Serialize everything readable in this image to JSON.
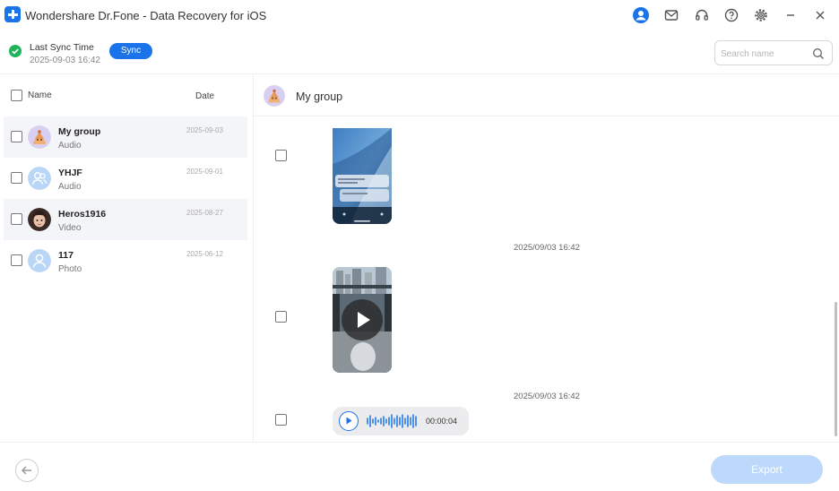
{
  "window": {
    "title": "Wondershare Dr.Fone - Data Recovery for iOS",
    "accent": "#1a73e8",
    "icons": [
      "account-icon",
      "mail-icon",
      "headset-icon",
      "help-icon",
      "settings-icon",
      "minimize-icon",
      "close-icon"
    ]
  },
  "sync": {
    "title": "Last Sync Time",
    "time": "2025-09-03 16:42",
    "button_label": "Sync",
    "status_color": "#1fb35a"
  },
  "search": {
    "placeholder": "Search name"
  },
  "list": {
    "header_name": "Name",
    "header_date": "Date",
    "items": [
      {
        "name": "My group",
        "type": "Audio",
        "date": "2025-09-03"
      },
      {
        "name": "YHJF",
        "type": "Audio",
        "date": "2025-09-01"
      },
      {
        "name": "Heros1916",
        "type": "Video",
        "date": "2025-08-27"
      },
      {
        "name": "117",
        "type": "Photo",
        "date": "2025-06-12"
      }
    ]
  },
  "chat": {
    "title": "My group",
    "messages": [
      {
        "kind": "image"
      },
      {
        "kind": "video",
        "timestamp": "2025/09/03 16:42"
      },
      {
        "kind": "voice",
        "timestamp": "2025/09/03 16:42",
        "duration": "00:00:04"
      }
    ]
  },
  "footer": {
    "export_label": "Export",
    "export_color": "#bcd8fb"
  }
}
